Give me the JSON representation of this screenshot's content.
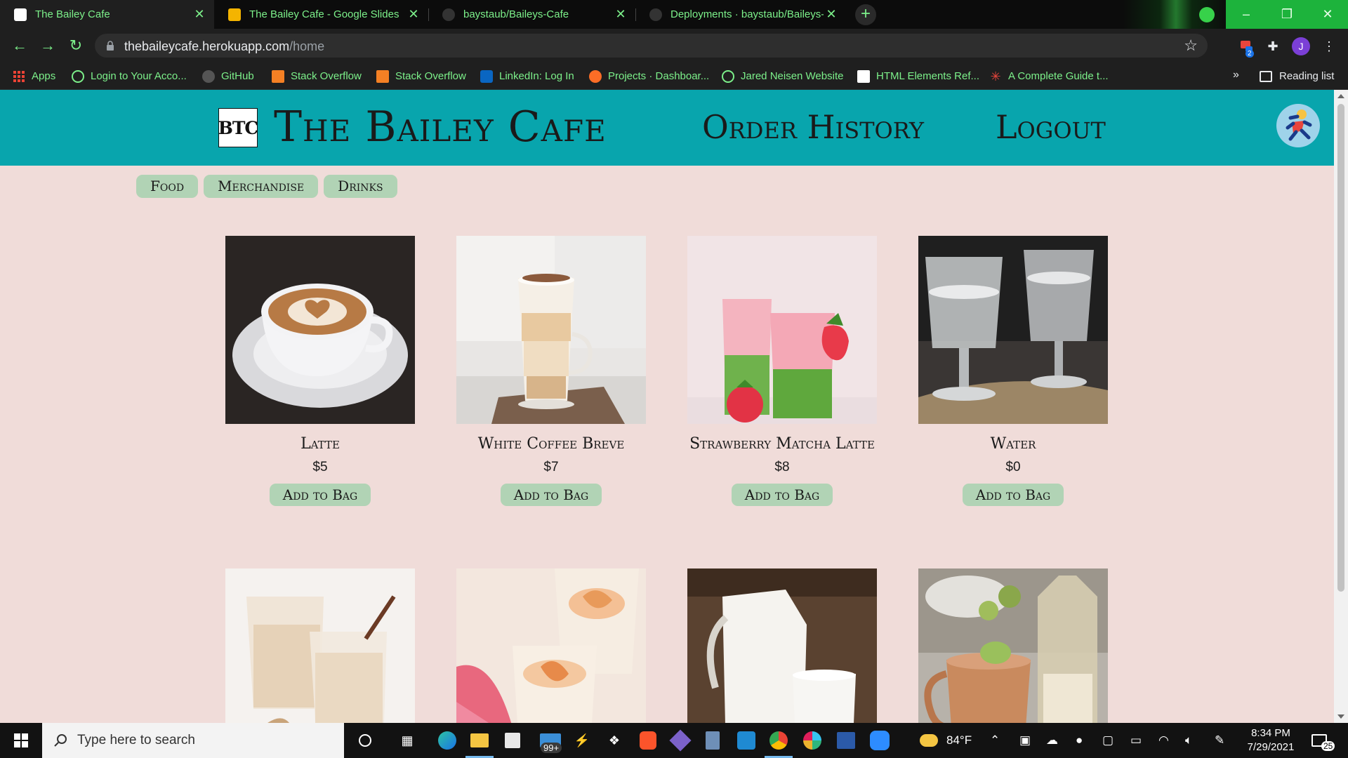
{
  "browser": {
    "tabs": [
      {
        "title": "The Bailey Cafe",
        "active": true,
        "favicon_color": "#ffffff"
      },
      {
        "title": "The Bailey Cafe - Google Slides",
        "active": false,
        "favicon_color": "#f4b400"
      },
      {
        "title": "baystaub/Baileys-Cafe",
        "active": false,
        "favicon_color": "#333333"
      },
      {
        "title": "Deployments · baystaub/Baileys-",
        "active": false,
        "favicon_color": "#333333"
      }
    ],
    "new_tab_label": "+",
    "window_controls": {
      "minimize": "–",
      "restore": "❐",
      "close": "✕"
    },
    "url_host": "thebaileycafe.herokuapp.com",
    "url_path": "/home",
    "extension_badge": "2",
    "profile_initial": "J",
    "bookmarks": [
      {
        "label": "Apps",
        "icon": "apps-grid-icon",
        "color": "#ea4335"
      },
      {
        "label": "Login to Your Acco...",
        "icon": "globe-icon",
        "color": "#7cf08a"
      },
      {
        "label": "GitHub",
        "icon": "github-icon",
        "color": "#555555"
      },
      {
        "label": "Stack Overflow",
        "icon": "stackoverflow-icon",
        "color": "#f48024"
      },
      {
        "label": "Stack Overflow",
        "icon": "stackoverflow-icon",
        "color": "#f48024"
      },
      {
        "label": "LinkedIn: Log In",
        "icon": "linkedin-icon",
        "color": "#0a66c2"
      },
      {
        "label": "Projects · Dashboar...",
        "icon": "gitlab-icon",
        "color": "#fc6d26"
      },
      {
        "label": "Jared Neisen Website",
        "icon": "globe-icon",
        "color": "#7cf08a"
      },
      {
        "label": "HTML Elements Ref...",
        "icon": "mdn-icon",
        "color": "#ffffff"
      },
      {
        "label": "A Complete Guide t...",
        "icon": "css-tricks-icon",
        "color": "#e8453c"
      }
    ],
    "bookmarks_more": "»",
    "reading_list": "Reading list"
  },
  "site": {
    "logo_text": "BTC",
    "title": "The Bailey Cafe",
    "nav": {
      "order_history": "Order History",
      "logout": "Logout"
    },
    "categories": [
      "Food",
      "Merchandise",
      "Drinks"
    ],
    "add_label": "Add to Bag",
    "products": [
      {
        "name": "Latte",
        "price": "$5",
        "image": "latte-photo"
      },
      {
        "name": "White Coffee Breve",
        "price": "$7",
        "image": "coffee-breve-photo"
      },
      {
        "name": "Strawberry Matcha Latte",
        "price": "$8",
        "image": "strawberry-matcha-photo"
      },
      {
        "name": "Water",
        "price": "$0",
        "image": "water-glasses-photo"
      },
      {
        "name": "",
        "price": "",
        "image": "chai-photo"
      },
      {
        "name": "",
        "price": "",
        "image": "peach-smoothie-photo"
      },
      {
        "name": "",
        "price": "",
        "image": "milk-photo"
      },
      {
        "name": "",
        "price": "",
        "image": "moscow-mule-photo"
      }
    ],
    "colors": {
      "header": "#08a5ad",
      "page_bg": "#f0dcd9",
      "button": "#b1d3b5"
    }
  },
  "taskbar": {
    "search_placeholder": "Type here to search",
    "badge_count": "99+",
    "weather": "84°F",
    "time": "8:34 PM",
    "date": "7/29/2021",
    "notifications": "25"
  }
}
